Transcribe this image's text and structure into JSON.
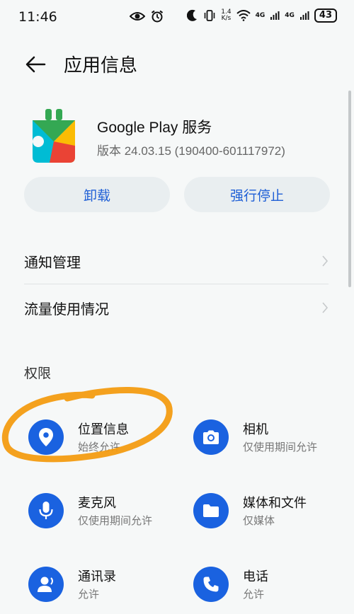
{
  "status_bar": {
    "time": "11:46",
    "network_speed_value": "1.4",
    "network_speed_unit": "K/s",
    "sim1_tag": "4G",
    "sim2_tag": "4G",
    "battery": "43"
  },
  "header": {
    "title": "应用信息"
  },
  "app": {
    "name": "Google Play 服务",
    "version": "版本 24.03.15 (190400-601117972)"
  },
  "actions": {
    "uninstall": "卸载",
    "force_stop": "强行停止"
  },
  "list": [
    {
      "label": "通知管理"
    },
    {
      "label": "流量使用情况"
    }
  ],
  "permissions_section": {
    "title": "权限"
  },
  "permissions": [
    {
      "title": "位置信息",
      "status": "始终允许",
      "icon": "location-pin-icon"
    },
    {
      "title": "相机",
      "status": "仅使用期间允许",
      "icon": "camera-icon"
    },
    {
      "title": "麦克风",
      "status": "仅使用期间允许",
      "icon": "microphone-icon"
    },
    {
      "title": "媒体和文件",
      "status": "仅媒体",
      "icon": "folder-icon"
    },
    {
      "title": "通讯录",
      "status": "允许",
      "icon": "contacts-icon"
    },
    {
      "title": "电话",
      "status": "允许",
      "icon": "phone-icon"
    }
  ],
  "colors": {
    "accent": "#1a62e0",
    "button_text": "#1f5fd6",
    "highlight_annotation": "#f39c12",
    "background": "#f6f8f8"
  }
}
